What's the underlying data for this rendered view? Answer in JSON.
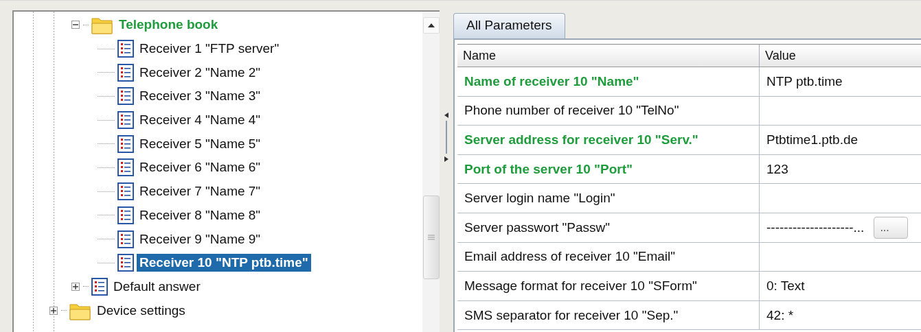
{
  "tree": [
    {
      "label": "Telephone book",
      "kind": "folder",
      "expanded": true,
      "selected": false,
      "modified": true,
      "children": [
        {
          "label": "Receiver 1 \"FTP server\"",
          "kind": "list",
          "selected": false,
          "modified": false
        },
        {
          "label": "Receiver 2 \"Name 2\"",
          "kind": "list",
          "selected": false,
          "modified": false
        },
        {
          "label": "Receiver 3 \"Name 3\"",
          "kind": "list",
          "selected": false,
          "modified": false
        },
        {
          "label": "Receiver 4 \"Name 4\"",
          "kind": "list",
          "selected": false,
          "modified": false
        },
        {
          "label": "Receiver 5 \"Name 5\"",
          "kind": "list",
          "selected": false,
          "modified": false
        },
        {
          "label": "Receiver 6 \"Name 6\"",
          "kind": "list",
          "selected": false,
          "modified": false
        },
        {
          "label": "Receiver 7 \"Name 7\"",
          "kind": "list",
          "selected": false,
          "modified": false
        },
        {
          "label": "Receiver 8 \"Name 8\"",
          "kind": "list",
          "selected": false,
          "modified": false
        },
        {
          "label": "Receiver 9 \"Name 9\"",
          "kind": "list",
          "selected": false,
          "modified": false
        },
        {
          "label": "Receiver 10 \"NTP ptb.time\"",
          "kind": "list",
          "selected": true,
          "modified": false
        }
      ]
    },
    {
      "label": "Default answer",
      "kind": "list",
      "expanded": false,
      "selected": false,
      "modified": false
    }
  ],
  "tree_root": [
    {
      "label": "Device settings",
      "kind": "folder",
      "expanded": false,
      "selected": false,
      "modified": false
    }
  ],
  "tabs": [
    {
      "label": "All Parameters",
      "selected": true
    }
  ],
  "table": {
    "columns": [
      "Name",
      "Value"
    ],
    "rows": [
      {
        "name": "Name of receiver 10 \"Name\"",
        "value": "NTP ptb.time",
        "modified": true
      },
      {
        "name": "Phone number of receiver 10 \"TelNo\"",
        "value": "",
        "modified": false
      },
      {
        "name": "Server address for receiver 10 \"Serv.\"",
        "value": "Ptbtime1.ptb.de",
        "modified": true
      },
      {
        "name": "Port of the server 10 \"Port\"",
        "value": "123",
        "modified": true
      },
      {
        "name": "Server login name \"Login\"",
        "value": "",
        "modified": false
      },
      {
        "name": "Server passwort \"Passw\"",
        "value": "--------------------...",
        "modified": false,
        "kind": "password",
        "button": "..."
      },
      {
        "name": "Email address of receiver 10 \"Email\"",
        "value": "",
        "modified": false
      },
      {
        "name": "Message format for receiver 10 \"SForm\"",
        "value": "0: Text",
        "modified": false
      },
      {
        "name": "SMS separator for receiver 10 \"Sep.\"",
        "value": "42: *",
        "modified": false
      }
    ]
  }
}
